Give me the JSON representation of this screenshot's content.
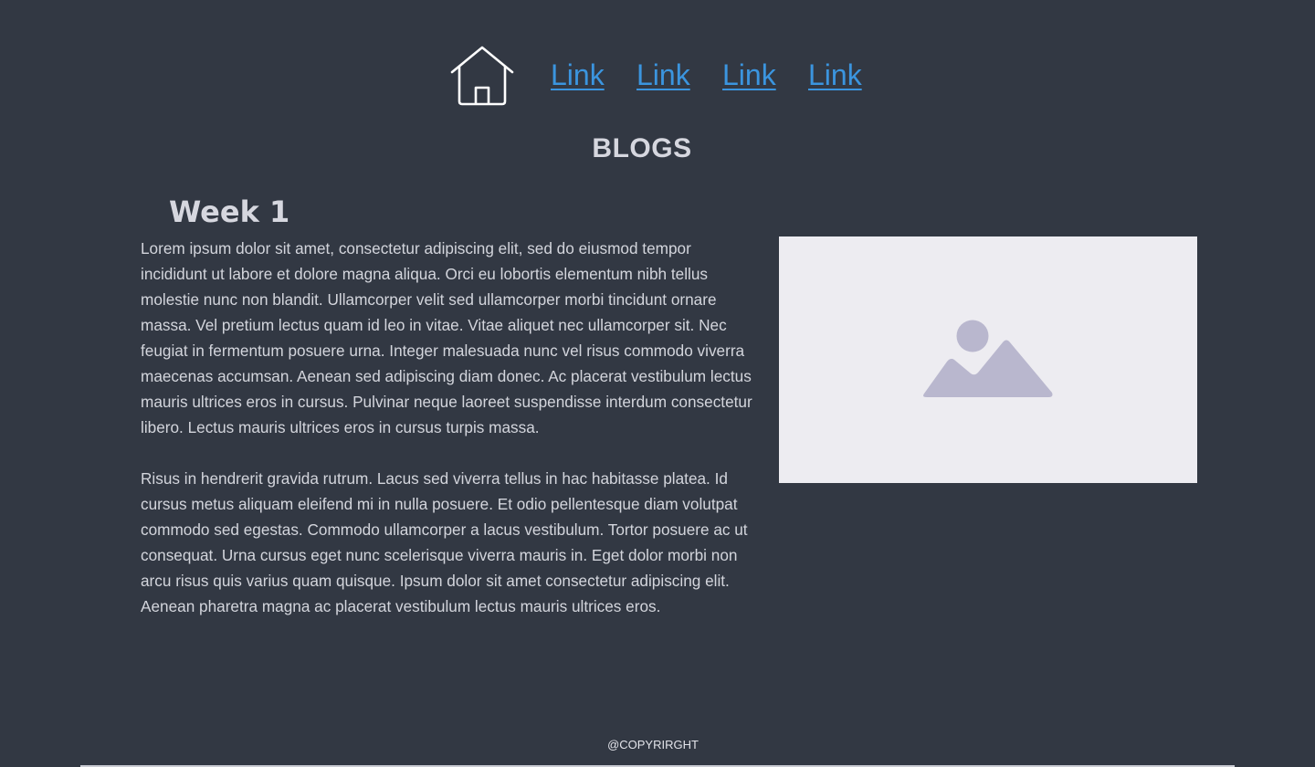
{
  "nav": {
    "home_icon": "home-icon",
    "links": [
      "Link",
      "Link",
      "Link",
      "Link"
    ],
    "link_color": "#3b95df"
  },
  "page": {
    "title": "BLOGS",
    "background": "#323843"
  },
  "post": {
    "title": "Week 1",
    "paragraphs": [
      "Lorem ipsum dolor sit amet, consectetur adipiscing elit, sed do eiusmod tempor incididunt ut labore et dolore magna aliqua. Orci eu lobortis elementum nibh tellus molestie nunc non blandit. Ullamcorper velit sed ullamcorper morbi tincidunt ornare massa. Vel pretium lectus quam id leo in vitae. Vitae aliquet nec ullamcorper sit. Nec feugiat in fermentum posuere urna. Integer malesuada nunc vel risus commodo viverra maecenas accumsan. Aenean sed adipiscing diam donec. Ac placerat vestibulum lectus mauris ultrices eros in cursus. Pulvinar neque laoreet suspendisse interdum consectetur libero. Lectus mauris ultrices eros in cursus turpis massa.",
      "Risus in hendrerit gravida rutrum. Lacus sed viverra tellus in hac habitasse platea. Id cursus metus aliquam eleifend mi in nulla posuere. Et odio pellentesque diam volutpat commodo sed egestas. Commodo ullamcorper a lacus vestibulum. Tortor posuere ac ut consequat. Urna cursus eget nunc scelerisque viverra mauris in. Eget dolor morbi non arcu risus quis varius quam quisque. Ipsum dolor sit amet consectetur adipiscing elit. Aenean pharetra magna ac placerat vestibulum lectus mauris ultrices eros."
    ],
    "image_icon": "image-placeholder-icon"
  },
  "footer": {
    "text": "@COPYRIRGHT"
  }
}
